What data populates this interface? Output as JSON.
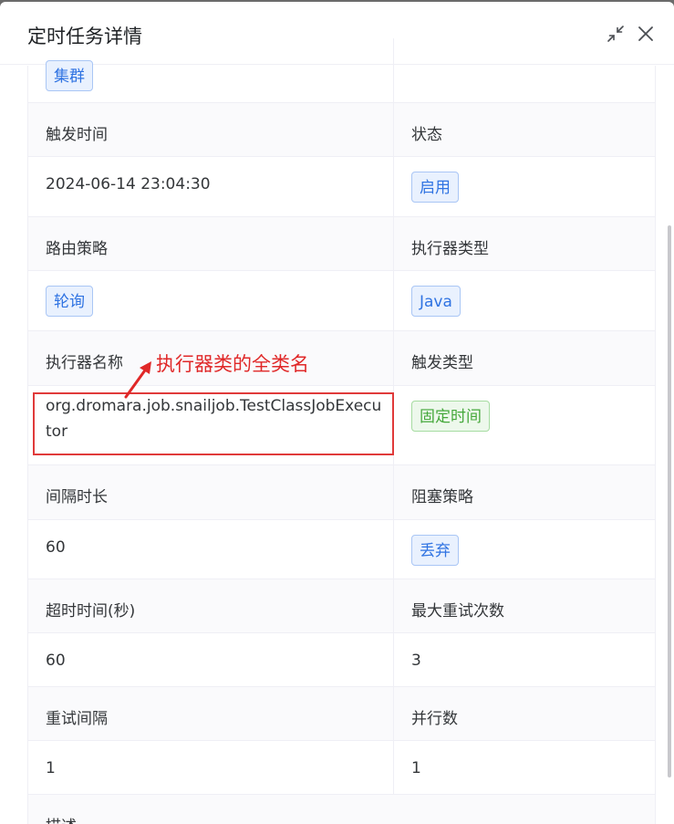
{
  "dialog": {
    "title": "定时任务详情"
  },
  "annotation": {
    "text": "执行器类的全类名",
    "color": "#e02828"
  },
  "details": {
    "prev_tag": "集群",
    "trigger_time_label": "触发时间",
    "trigger_time_value": "2024-06-14 23:04:30",
    "status_label": "状态",
    "status_value": "启用",
    "route_label": "路由策略",
    "route_value": "轮询",
    "executor_type_label": "执行器类型",
    "executor_type_value": "Java",
    "executor_name_label": "执行器名称",
    "executor_name_value": "org.dromara.job.snailjob.TestClassJobExecutor",
    "trigger_type_label": "触发类型",
    "trigger_type_value": "固定时间",
    "interval_label": "间隔时长",
    "interval_value": "60",
    "block_label": "阻塞策略",
    "block_value": "丢弃",
    "timeout_label": "超时时间(秒)",
    "timeout_value": "60",
    "max_retry_label": "最大重试次数",
    "max_retry_value": "3",
    "retry_interval_label": "重试间隔",
    "retry_interval_value": "1",
    "parallel_label": "并行数",
    "parallel_value": "1",
    "desc_label": "描述"
  }
}
